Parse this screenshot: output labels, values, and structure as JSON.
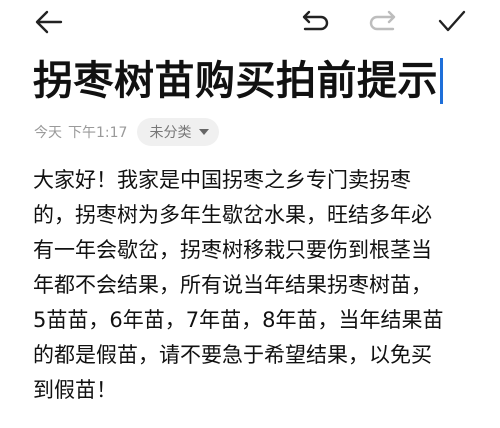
{
  "toolbar": {
    "back_icon": "back-arrow-icon",
    "undo_icon": "undo-icon",
    "redo_icon": "redo-icon",
    "done_icon": "checkmark-icon",
    "redo_enabled": false
  },
  "note": {
    "title": "拐枣树苗购买拍前提示",
    "date": "今天",
    "time": "下午1:17",
    "category": "未分类",
    "body_lines": [
      "大家好！我家是中国拐枣之乡专门卖拐枣",
      "的，拐枣树为多年生歇岔水果，旺结多年必",
      "有一年会歇岔，拐枣树移栽只要伤到根茎当",
      "年都不会结果，所有说当年结果拐枣树苗，",
      "5苗苗，6年苗，7年苗，8年苗，当年结果苗",
      "的都是假苗，请不要急于希望结果，以免买",
      "到假苗！"
    ]
  },
  "colors": {
    "caret": "#1e6fd9",
    "meta_text": "#9a9a9a",
    "pill_bg": "#f0f0f0",
    "icon": "#222222",
    "icon_disabled": "#bdbdbd"
  }
}
